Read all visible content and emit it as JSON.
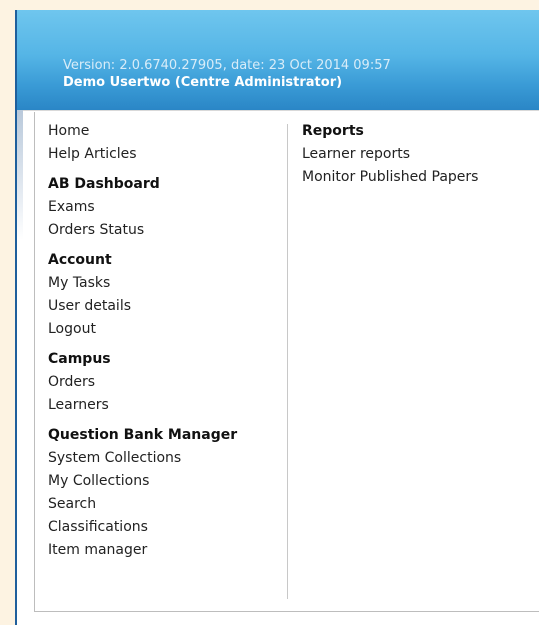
{
  "header": {
    "version_text": "Version: 2.0.6740.27905, date: 23 Oct 2014 09:57",
    "user_text": "Demo Usertwo (Centre Administrator)"
  },
  "menu": {
    "top_links": [
      "Home",
      "Help Articles"
    ],
    "sections": [
      {
        "title": "AB Dashboard",
        "items": [
          "Exams",
          "Orders Status"
        ]
      },
      {
        "title": "Account",
        "items": [
          "My Tasks",
          "User details",
          "Logout"
        ]
      },
      {
        "title": "Campus",
        "items": [
          "Orders",
          "Learners"
        ]
      },
      {
        "title": "Question Bank Manager",
        "items": [
          "System Collections",
          "My Collections",
          "Search",
          "Classifications",
          "Item manager"
        ]
      }
    ],
    "right_sections": [
      {
        "title": "Reports",
        "items": [
          "Learner reports",
          "Monitor Published Papers"
        ]
      }
    ]
  },
  "colors": {
    "header_top": "#6fc6ee",
    "header_bottom": "#2a86c6",
    "page_background": "#fdf3e2"
  }
}
